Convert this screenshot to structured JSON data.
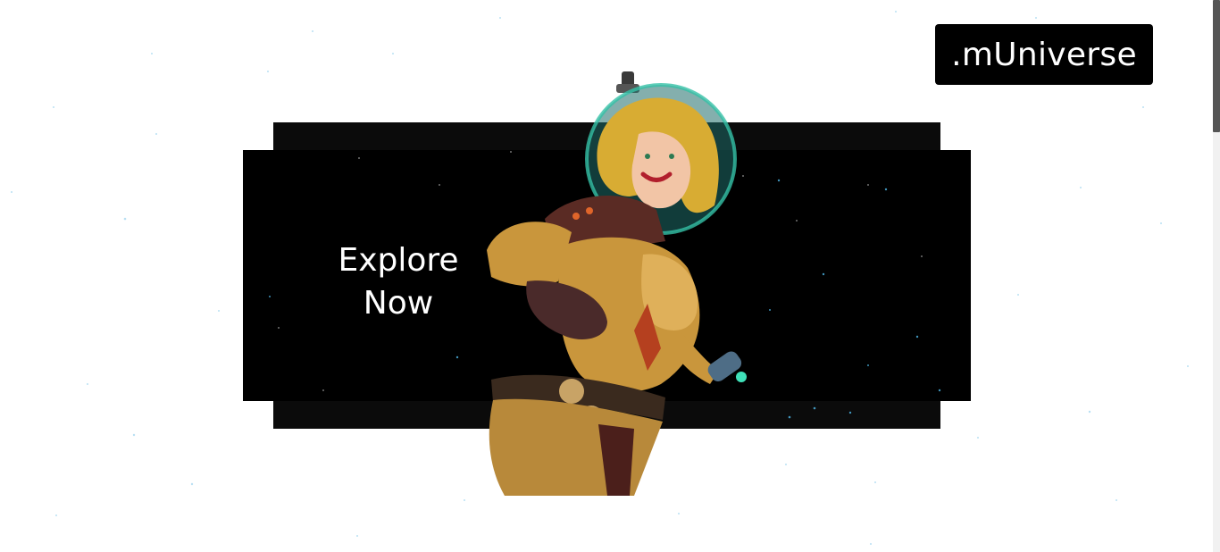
{
  "brand": {
    "logo_text": ".mUniverse"
  },
  "hero": {
    "cta_line1": "Explore",
    "cta_line2": "Now"
  },
  "colors": {
    "star_blue": "#2a9fd6",
    "suit_gold": "#c9963c",
    "helmet_teal": "#2bb39b",
    "hair_blonde": "#e2b73d"
  },
  "icons": {
    "hero_character": "astronaut-heroine-illustration"
  }
}
